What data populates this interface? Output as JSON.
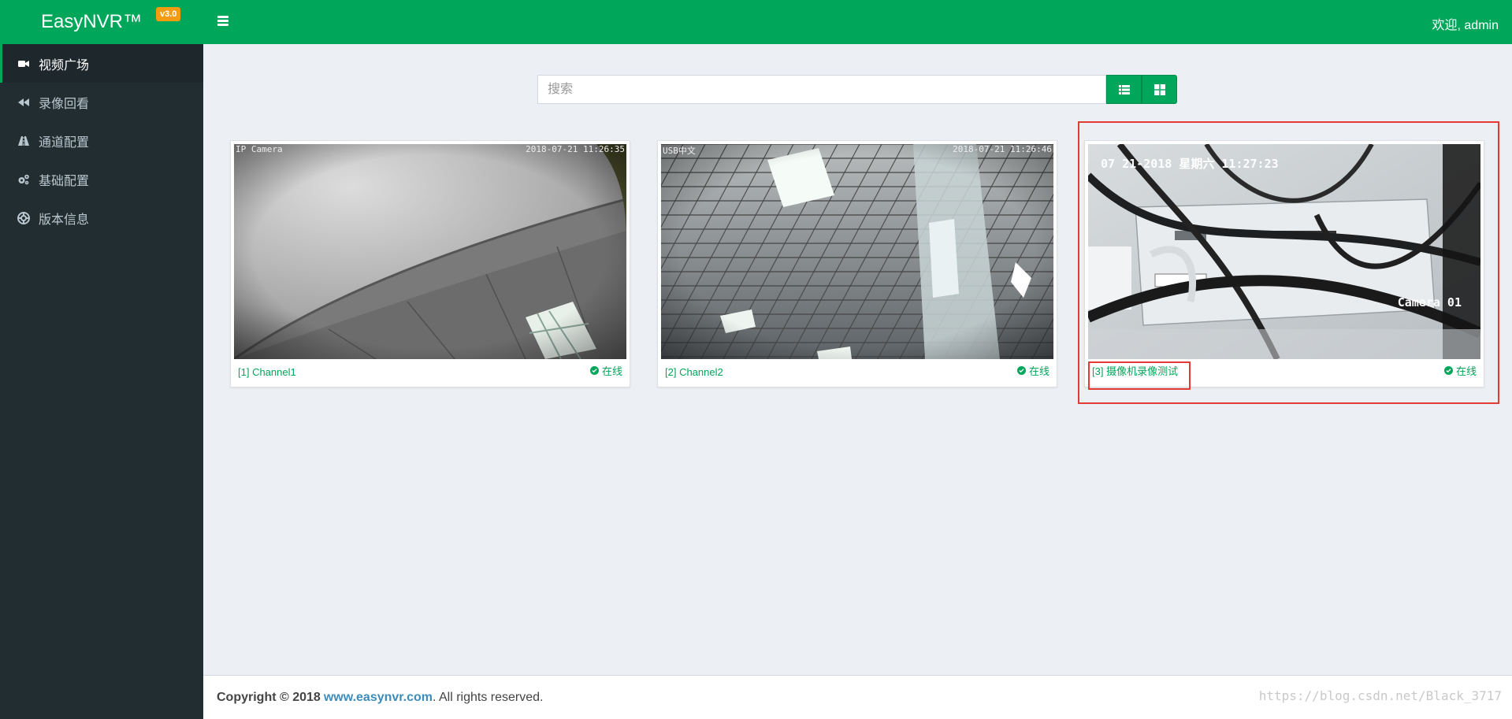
{
  "app": {
    "brand": "EasyNVR™",
    "version": "v3.0",
    "welcome": "欢迎, admin",
    "accent": "#00a65a"
  },
  "sidebar": {
    "items": [
      {
        "label": "视频广场",
        "icon": "video-icon",
        "active": true
      },
      {
        "label": "录像回看",
        "icon": "rewind-icon",
        "active": false
      },
      {
        "label": "通道配置",
        "icon": "road-icon",
        "active": false
      },
      {
        "label": "基础配置",
        "icon": "cogs-icon",
        "active": false
      },
      {
        "label": "版本信息",
        "icon": "life-ring-icon",
        "active": false
      }
    ]
  },
  "search": {
    "placeholder": "搜索",
    "value": ""
  },
  "channels": [
    {
      "caption": "[1] Channel1",
      "status": "在线",
      "osd_left": "IP Camera",
      "osd_right": "2018-07-21 11:26:35"
    },
    {
      "caption": "[2] Channel2",
      "status": "在线",
      "osd_left": "USB中文",
      "osd_right": "2018-07-21 11:26:46"
    },
    {
      "caption": "[3] 摄像机录像测试",
      "status": "在线",
      "osd_left": "07 21-2018 星期六 11:27:23",
      "osd_right": "Camera 01"
    }
  ],
  "footer": {
    "prefix": "Copyright © 2018",
    "link": "www.easynvr.com",
    "suffix": ". All rights reserved.",
    "watermark": "https://blog.csdn.net/Black_3717"
  }
}
